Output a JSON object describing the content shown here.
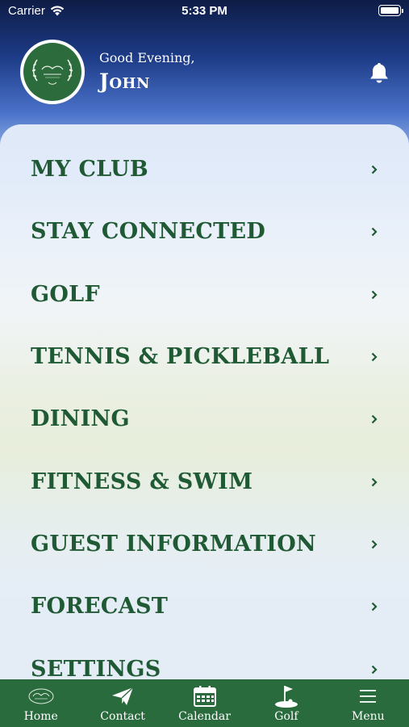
{
  "status_bar": {
    "carrier": "Carrier",
    "time": "5:33 PM"
  },
  "header": {
    "greeting": "Good Evening,",
    "user_name": "John",
    "logo_icon": "club-logo-icon",
    "bell_icon": "bell-icon"
  },
  "menu": {
    "items": [
      {
        "label": "MY CLUB"
      },
      {
        "label": "STAY CONNECTED"
      },
      {
        "label": "GOLF"
      },
      {
        "label": "TENNIS & PICKLEBALL"
      },
      {
        "label": "DINING"
      },
      {
        "label": "FITNESS & SWIM"
      },
      {
        "label": "GUEST INFORMATION"
      },
      {
        "label": "FORECAST"
      },
      {
        "label": "SETTINGS"
      }
    ]
  },
  "tabbar": {
    "tabs": [
      {
        "label": "Home",
        "icon": "club-logo-icon"
      },
      {
        "label": "Contact",
        "icon": "paper-plane-icon"
      },
      {
        "label": "Calendar",
        "icon": "calendar-icon"
      },
      {
        "label": "Golf",
        "icon": "golf-flag-icon"
      },
      {
        "label": "Menu",
        "icon": "hamburger-icon"
      }
    ]
  },
  "colors": {
    "brand_green": "#2a6b3d",
    "menu_text": "#1f5a34",
    "header_blue": "#1d3b86"
  }
}
